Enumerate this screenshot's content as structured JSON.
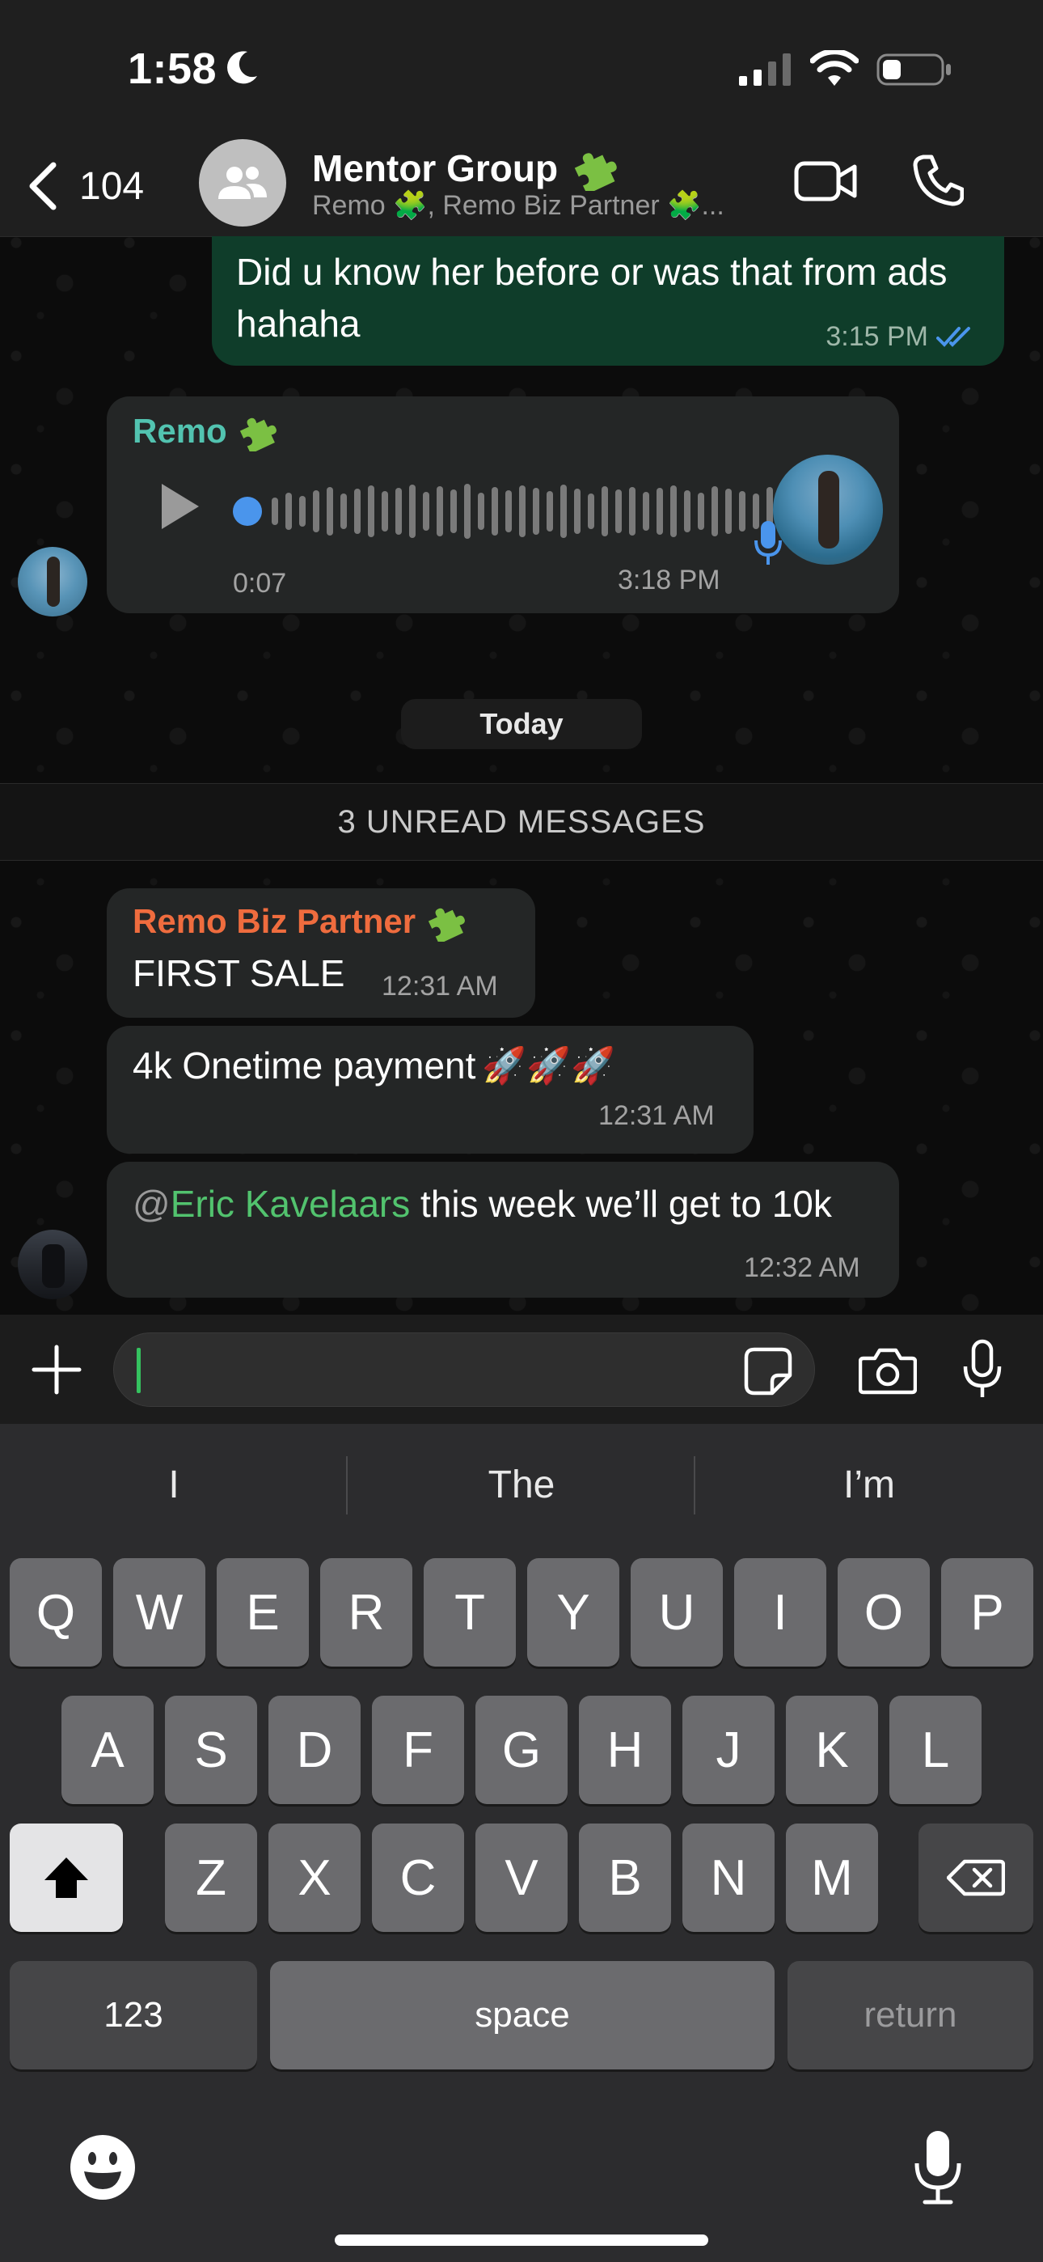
{
  "status_bar": {
    "time": "1:58",
    "icons": [
      "moon-icon",
      "signal-icon",
      "wifi-icon",
      "battery-icon"
    ]
  },
  "header": {
    "back_count": "104",
    "title": "Mentor Group",
    "subtitle": "Remo 🧩, Remo Biz Partner 🧩...",
    "icons": [
      "back-chevron-icon",
      "group-avatar-icon",
      "video-call-icon",
      "phone-icon"
    ]
  },
  "messages": {
    "outgoing": {
      "text": "Did u know her before or was that from ads hahaha",
      "time": "3:15 PM",
      "status": "read"
    },
    "voice": {
      "sender": "Remo",
      "duration": "0:07",
      "time": "3:18 PM"
    },
    "date_divider": "Today",
    "unread_banner": "3 UNREAD MESSAGES",
    "msg1": {
      "sender": "Remo Biz Partner",
      "text": "FIRST SALE",
      "time": "12:31 AM"
    },
    "msg2": {
      "text": "4k Onetime payment",
      "emoji": "🚀🚀🚀",
      "time": "12:31 AM"
    },
    "msg3": {
      "at": "@",
      "mention": "Eric Kavelaars",
      "text": " this week we’ll get to 10k",
      "time": "12:32 AM"
    }
  },
  "composer": {
    "value": "",
    "icons": [
      "plus-icon",
      "sticker-icon",
      "camera-icon",
      "mic-icon"
    ]
  },
  "keyboard": {
    "suggestions": [
      "I",
      "The",
      "I’m"
    ],
    "row1": [
      "Q",
      "W",
      "E",
      "R",
      "T",
      "Y",
      "U",
      "I",
      "O",
      "P"
    ],
    "row2": [
      "A",
      "S",
      "D",
      "F",
      "G",
      "H",
      "J",
      "K",
      "L"
    ],
    "row3": [
      "Z",
      "X",
      "C",
      "V",
      "B",
      "N",
      "M"
    ],
    "numbers_key": "123",
    "space_key": "space",
    "return_key": "return"
  },
  "colors": {
    "outgoing_bubble": "#0f3d2a",
    "incoming_bubble": "#242626",
    "remo_name": "#52c3b0",
    "partner_name": "#ef6c3e",
    "mention": "#52c36e",
    "read_ticks": "#4a95ec"
  }
}
